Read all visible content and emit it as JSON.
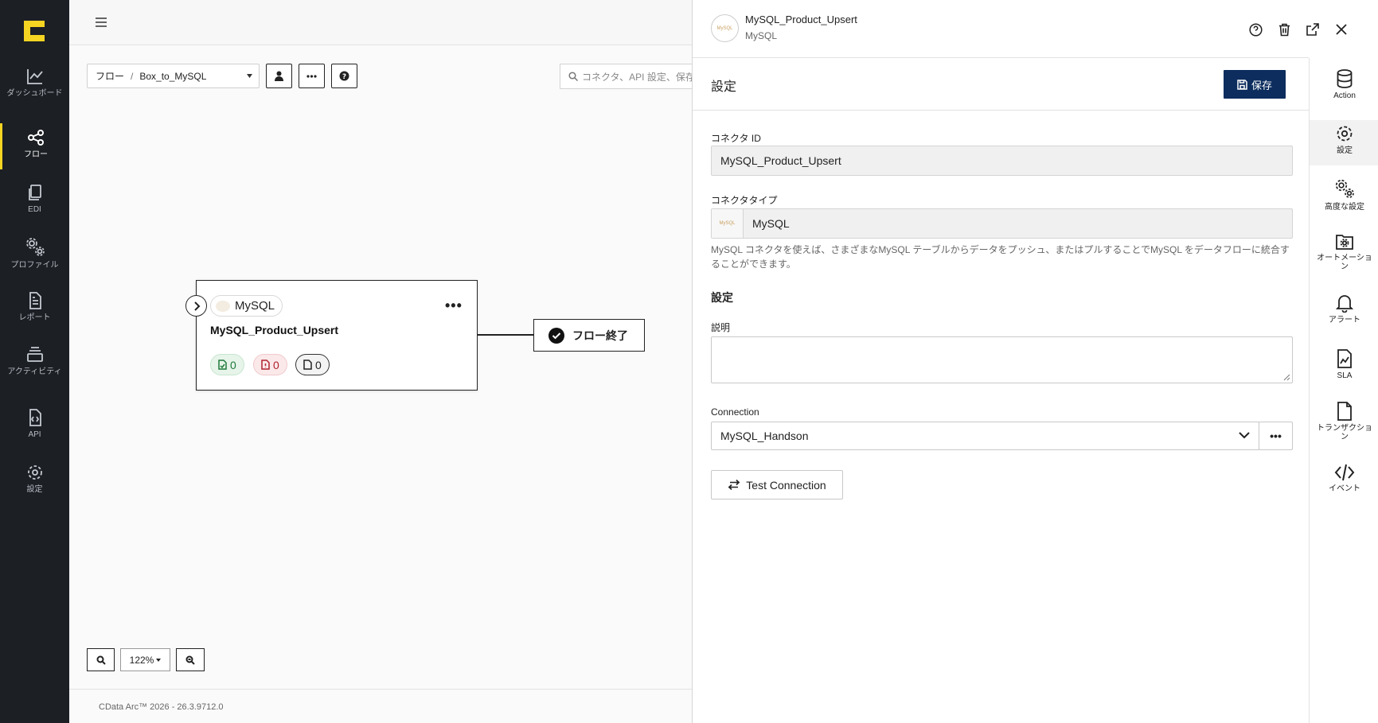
{
  "colors": {
    "sidebar_bg": "#1c1f24",
    "accent_yellow": "#f5d422",
    "save_bg": "#0c2d5e"
  },
  "sidebar": {
    "logo": "cdata-logo-icon",
    "items": [
      {
        "label": "ダッシュボード",
        "icon": "chart-line-icon"
      },
      {
        "label": "フロー",
        "icon": "share-nodes-icon",
        "active": true
      },
      {
        "label": "EDI",
        "icon": "documents-icon"
      },
      {
        "label": "プロファイル",
        "icon": "gears-icon"
      },
      {
        "label": "レポート",
        "icon": "report-icon"
      },
      {
        "label": "アクティビティ",
        "icon": "layers-icon"
      },
      {
        "label": "API",
        "icon": "api-file-icon"
      },
      {
        "label": "設定",
        "icon": "gear-icon"
      }
    ]
  },
  "toolbar": {
    "breadcrumb_root": "フロー",
    "breadcrumb_sep": "/",
    "breadcrumb_current": "Box_to_MySQL",
    "search_placeholder": "コネクタ、API 設定、保存"
  },
  "canvas": {
    "node": {
      "type_label": "MySQL",
      "title": "MySQL_Product_Upsert",
      "dots": "•••",
      "counts": {
        "success": "0",
        "error": "0",
        "pending": "0"
      }
    },
    "end_node_label": "フロー終了",
    "zoom_level": "122%"
  },
  "footer": {
    "version": "CData Arc™ 2026 - 26.3.9712.0"
  },
  "panel": {
    "header": {
      "title": "MySQL_Product_Upsert",
      "subtitle": "MySQL",
      "avatar_text": "MySQL"
    },
    "section_title": "設定",
    "save_label": "保存",
    "connector_id_label": "コネクタ ID",
    "connector_id_value": "MySQL_Product_Upsert",
    "connector_type_label": "コネクタタイプ",
    "connector_type_value": "MySQL",
    "connector_type_logo": "MySQL",
    "help_text": "MySQL コネクタを使えば、さまざまなMySQL テーブルからデータをプッシュ、またはプルすることでMySQL をデータフローに統合することができます。",
    "settings_heading": "設定",
    "description_label": "説明",
    "description_value": "",
    "connection_label": "Connection",
    "connection_value": "MySQL_Handson",
    "more_label": "•••",
    "test_connection_label": "Test Connection"
  },
  "rail": {
    "items": [
      {
        "label": "Action",
        "icon": "database-icon"
      },
      {
        "label": "設定",
        "icon": "gear-icon",
        "active": true
      },
      {
        "label": "高度な設定",
        "icon": "gears-icon"
      },
      {
        "label": "オートメーション",
        "icon": "folder-gear-icon"
      },
      {
        "label": "アラート",
        "icon": "bell-icon"
      },
      {
        "label": "SLA",
        "icon": "sla-file-icon"
      },
      {
        "label": "トランザクション",
        "icon": "file-icon"
      },
      {
        "label": "イベント",
        "icon": "code-icon"
      }
    ]
  }
}
